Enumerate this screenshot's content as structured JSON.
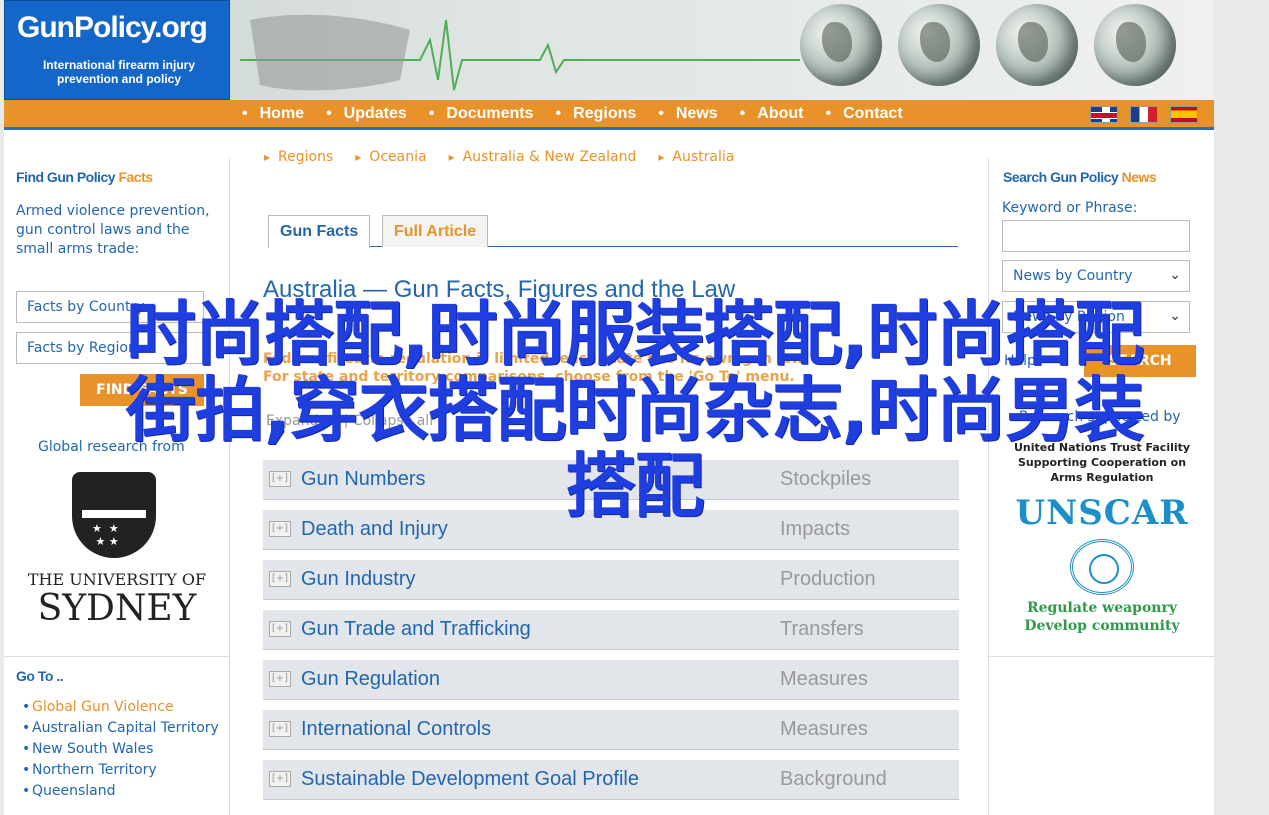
{
  "header": {
    "brand": "GunPolicy.org",
    "tagline": "International firearm injury prevention and policy"
  },
  "nav": {
    "items": [
      "Home",
      "Updates",
      "Documents",
      "Regions",
      "News",
      "About",
      "Contact"
    ],
    "flags": [
      "english-flag-icon",
      "french-flag-icon",
      "spanish-flag-icon"
    ]
  },
  "left": {
    "find_heading_a": "Find Gun Policy ",
    "find_heading_b": "Facts",
    "find_desc": "Armed violence prevention, gun control laws and the small arms trade:",
    "facts_by_country": "Facts by Country",
    "facts_by_region": "Facts by Region",
    "find_button": "FIND FACTS",
    "global_research": "Global research from",
    "univ_line1": "THE UNIVERSITY OF",
    "univ_line2": "SYDNEY",
    "goto_heading": "Go To ..",
    "goto_items": [
      "Global Gun Violence",
      "Australian Capital Territory",
      "New South Wales",
      "Northern Territory",
      "Queensland"
    ]
  },
  "right": {
    "search_heading_a": "Search Gun Policy ",
    "search_heading_b": "News",
    "keyword_label": "Keyword or Phrase:",
    "keyword_value": "",
    "news_by_country": "News by Country",
    "news_by_region": "News by Region",
    "help": "Help",
    "search_button": "SEARCH",
    "supported_by": "Research supported by",
    "unscar_line1": "United Nations Trust Facility Supporting Cooperation on Arms Regulation",
    "unscar_name": "UNSCAR",
    "unscar_slogan1": "Regulate weaponry",
    "unscar_slogan2": "Develop community"
  },
  "main": {
    "breadcrumbs": [
      "Regions",
      "Oceania",
      "Australia & New Zealand",
      "Australia"
    ],
    "tab_facts": "Gun Facts",
    "tab_article": "Full Article",
    "title": "Australia — Gun Facts, Figures and the Law",
    "note1": "Federal firearm regulation is limited, each state has its own gun law",
    "note2": "For state and territory comparisons, choose from the 'Go To' menu.",
    "expand_all": "Expand all  |  Collapse all",
    "rows": [
      {
        "name": "Gun Numbers",
        "cat": "Stockpiles"
      },
      {
        "name": "Death and Injury",
        "cat": "Impacts"
      },
      {
        "name": "Gun Industry",
        "cat": "Production"
      },
      {
        "name": "Gun Trade and Trafficking",
        "cat": "Transfers"
      },
      {
        "name": "Gun Regulation",
        "cat": "Measures"
      },
      {
        "name": "International Controls",
        "cat": "Measures"
      },
      {
        "name": "Sustainable Development Goal Profile",
        "cat": "Background"
      }
    ]
  },
  "overlay": {
    "line1": "时尚搭配,时尚服装搭配,时尚搭配",
    "line2": "街拍,穿衣搭配时尚杂志,时尚男装",
    "line3": "搭配"
  },
  "colors": {
    "brand_blue": "#1467c8",
    "nav_orange": "#e8922a",
    "link_blue": "#2266b0",
    "overlay_blue": "#1f3ee0"
  }
}
